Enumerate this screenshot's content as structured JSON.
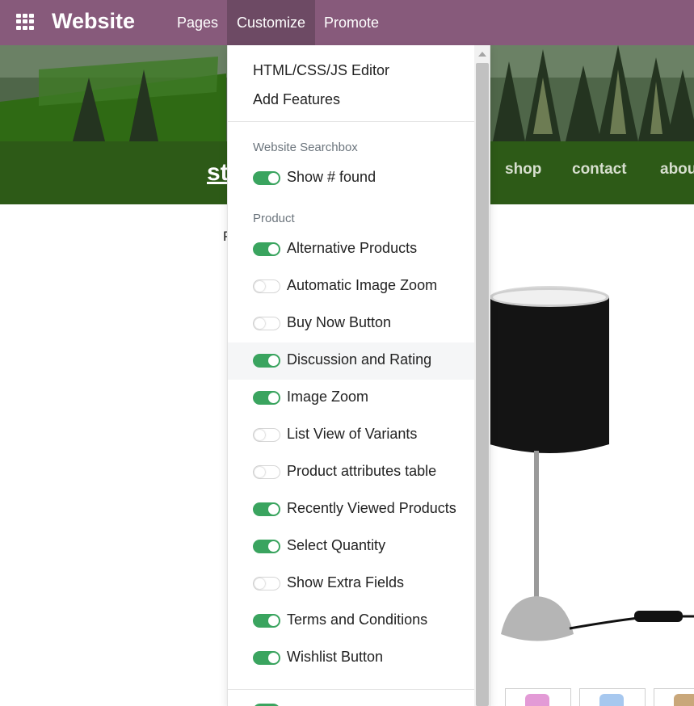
{
  "topbar": {
    "brand": "Website",
    "menus": [
      "Pages",
      "Customize",
      "Promote"
    ]
  },
  "site": {
    "logo": "st",
    "nav_links": [
      "shop",
      "contact",
      "abou"
    ],
    "breadcrumb_fragment": "P"
  },
  "dropdown": {
    "actions": [
      "HTML/CSS/JS Editor",
      "Add Features"
    ],
    "sections": [
      {
        "header": "Website Searchbox",
        "options": [
          {
            "label": "Show # found",
            "enabled": true
          }
        ]
      },
      {
        "header": "Product",
        "options": [
          {
            "label": "Alternative Products",
            "enabled": true
          },
          {
            "label": "Automatic Image Zoom",
            "enabled": false
          },
          {
            "label": "Buy Now Button",
            "enabled": false
          },
          {
            "label": "Discussion and Rating",
            "enabled": true
          },
          {
            "label": "Image Zoom",
            "enabled": true
          },
          {
            "label": "List View of Variants",
            "enabled": false
          },
          {
            "label": "Product attributes table",
            "enabled": false
          },
          {
            "label": "Recently Viewed Products",
            "enabled": true
          },
          {
            "label": "Select Quantity",
            "enabled": true
          },
          {
            "label": "Show Extra Fields",
            "enabled": false
          },
          {
            "label": "Terms and Conditions",
            "enabled": true
          },
          {
            "label": "Wishlist Button",
            "enabled": true
          }
        ]
      }
    ]
  },
  "colors": {
    "navbar": "#875a7b",
    "site_nav": "#2d5a17",
    "toggle_on": "#3aa45f"
  }
}
